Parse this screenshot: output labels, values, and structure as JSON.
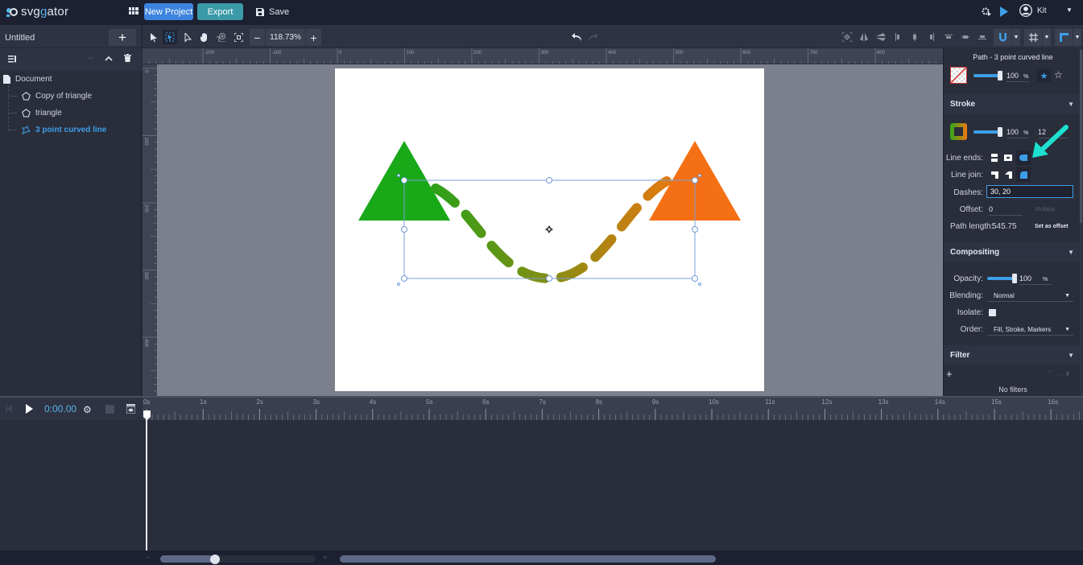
{
  "app": {
    "logo_prefix": "svg",
    "logo_accent": "g",
    "logo_suffix": "ator",
    "new_project_label": "New Project",
    "export_label": "Export",
    "save_label": "Save",
    "user_name": "Kit"
  },
  "document": {
    "title": "Untitled",
    "zoom_level": "118.73%"
  },
  "layers": {
    "root": "Document",
    "items": [
      {
        "label": "Copy of triangle",
        "type": "polygon",
        "selected": false
      },
      {
        "label": "triangle",
        "type": "polygon",
        "selected": false
      },
      {
        "label": "3 point curved line",
        "type": "path",
        "selected": true
      }
    ]
  },
  "rulers": {
    "horizontal_ticks": [
      "-200",
      "-100",
      "0",
      "100",
      "200",
      "300",
      "400",
      "500",
      "600",
      "700",
      "800"
    ],
    "vertical_ticks": [
      "0",
      "100",
      "200",
      "300",
      "400"
    ]
  },
  "inspector": {
    "title": "Path - 3 point curved line",
    "fill": {
      "opacity": "100",
      "unit": "%"
    },
    "stroke": {
      "header": "Stroke",
      "opacity": "100",
      "unit": "%",
      "width": "12",
      "line_ends_label": "Line ends:",
      "line_join_label": "Line join:",
      "dashes_label": "Dashes:",
      "dashes_value": "30, 20",
      "offset_label": "Offset:",
      "offset_value": "0",
      "multiply_label": "Multiply...",
      "path_length_label": "Path length:",
      "path_length_value": "545.75",
      "set_as_offset_label": "Set as offset"
    },
    "compositing": {
      "header": "Compositing",
      "opacity_label": "Opacity:",
      "opacity_value": "100",
      "unit": "%",
      "blending_label": "Blending:",
      "blending_value": "Normal",
      "isolate_label": "Isolate:",
      "order_label": "Order:",
      "order_value": "Fill, Stroke, Markers"
    },
    "filter": {
      "header": "Filter",
      "empty_label": "No filters"
    }
  },
  "timeline": {
    "time": "0:00.00",
    "marks": [
      "0s",
      "1s",
      "2s",
      "3s",
      "4s",
      "5s",
      "6s",
      "7s",
      "8s",
      "9s",
      "10s",
      "11s",
      "12s",
      "13s",
      "14s",
      "15s",
      "16s"
    ]
  },
  "colors": {
    "accent_blue": "#3d9ee8",
    "new_project": "#3d84e0",
    "export": "#3a9aa8",
    "triangle_green": "#18a818",
    "triangle_orange": "#f57015",
    "arrow_annotation": "#1de0d0"
  }
}
